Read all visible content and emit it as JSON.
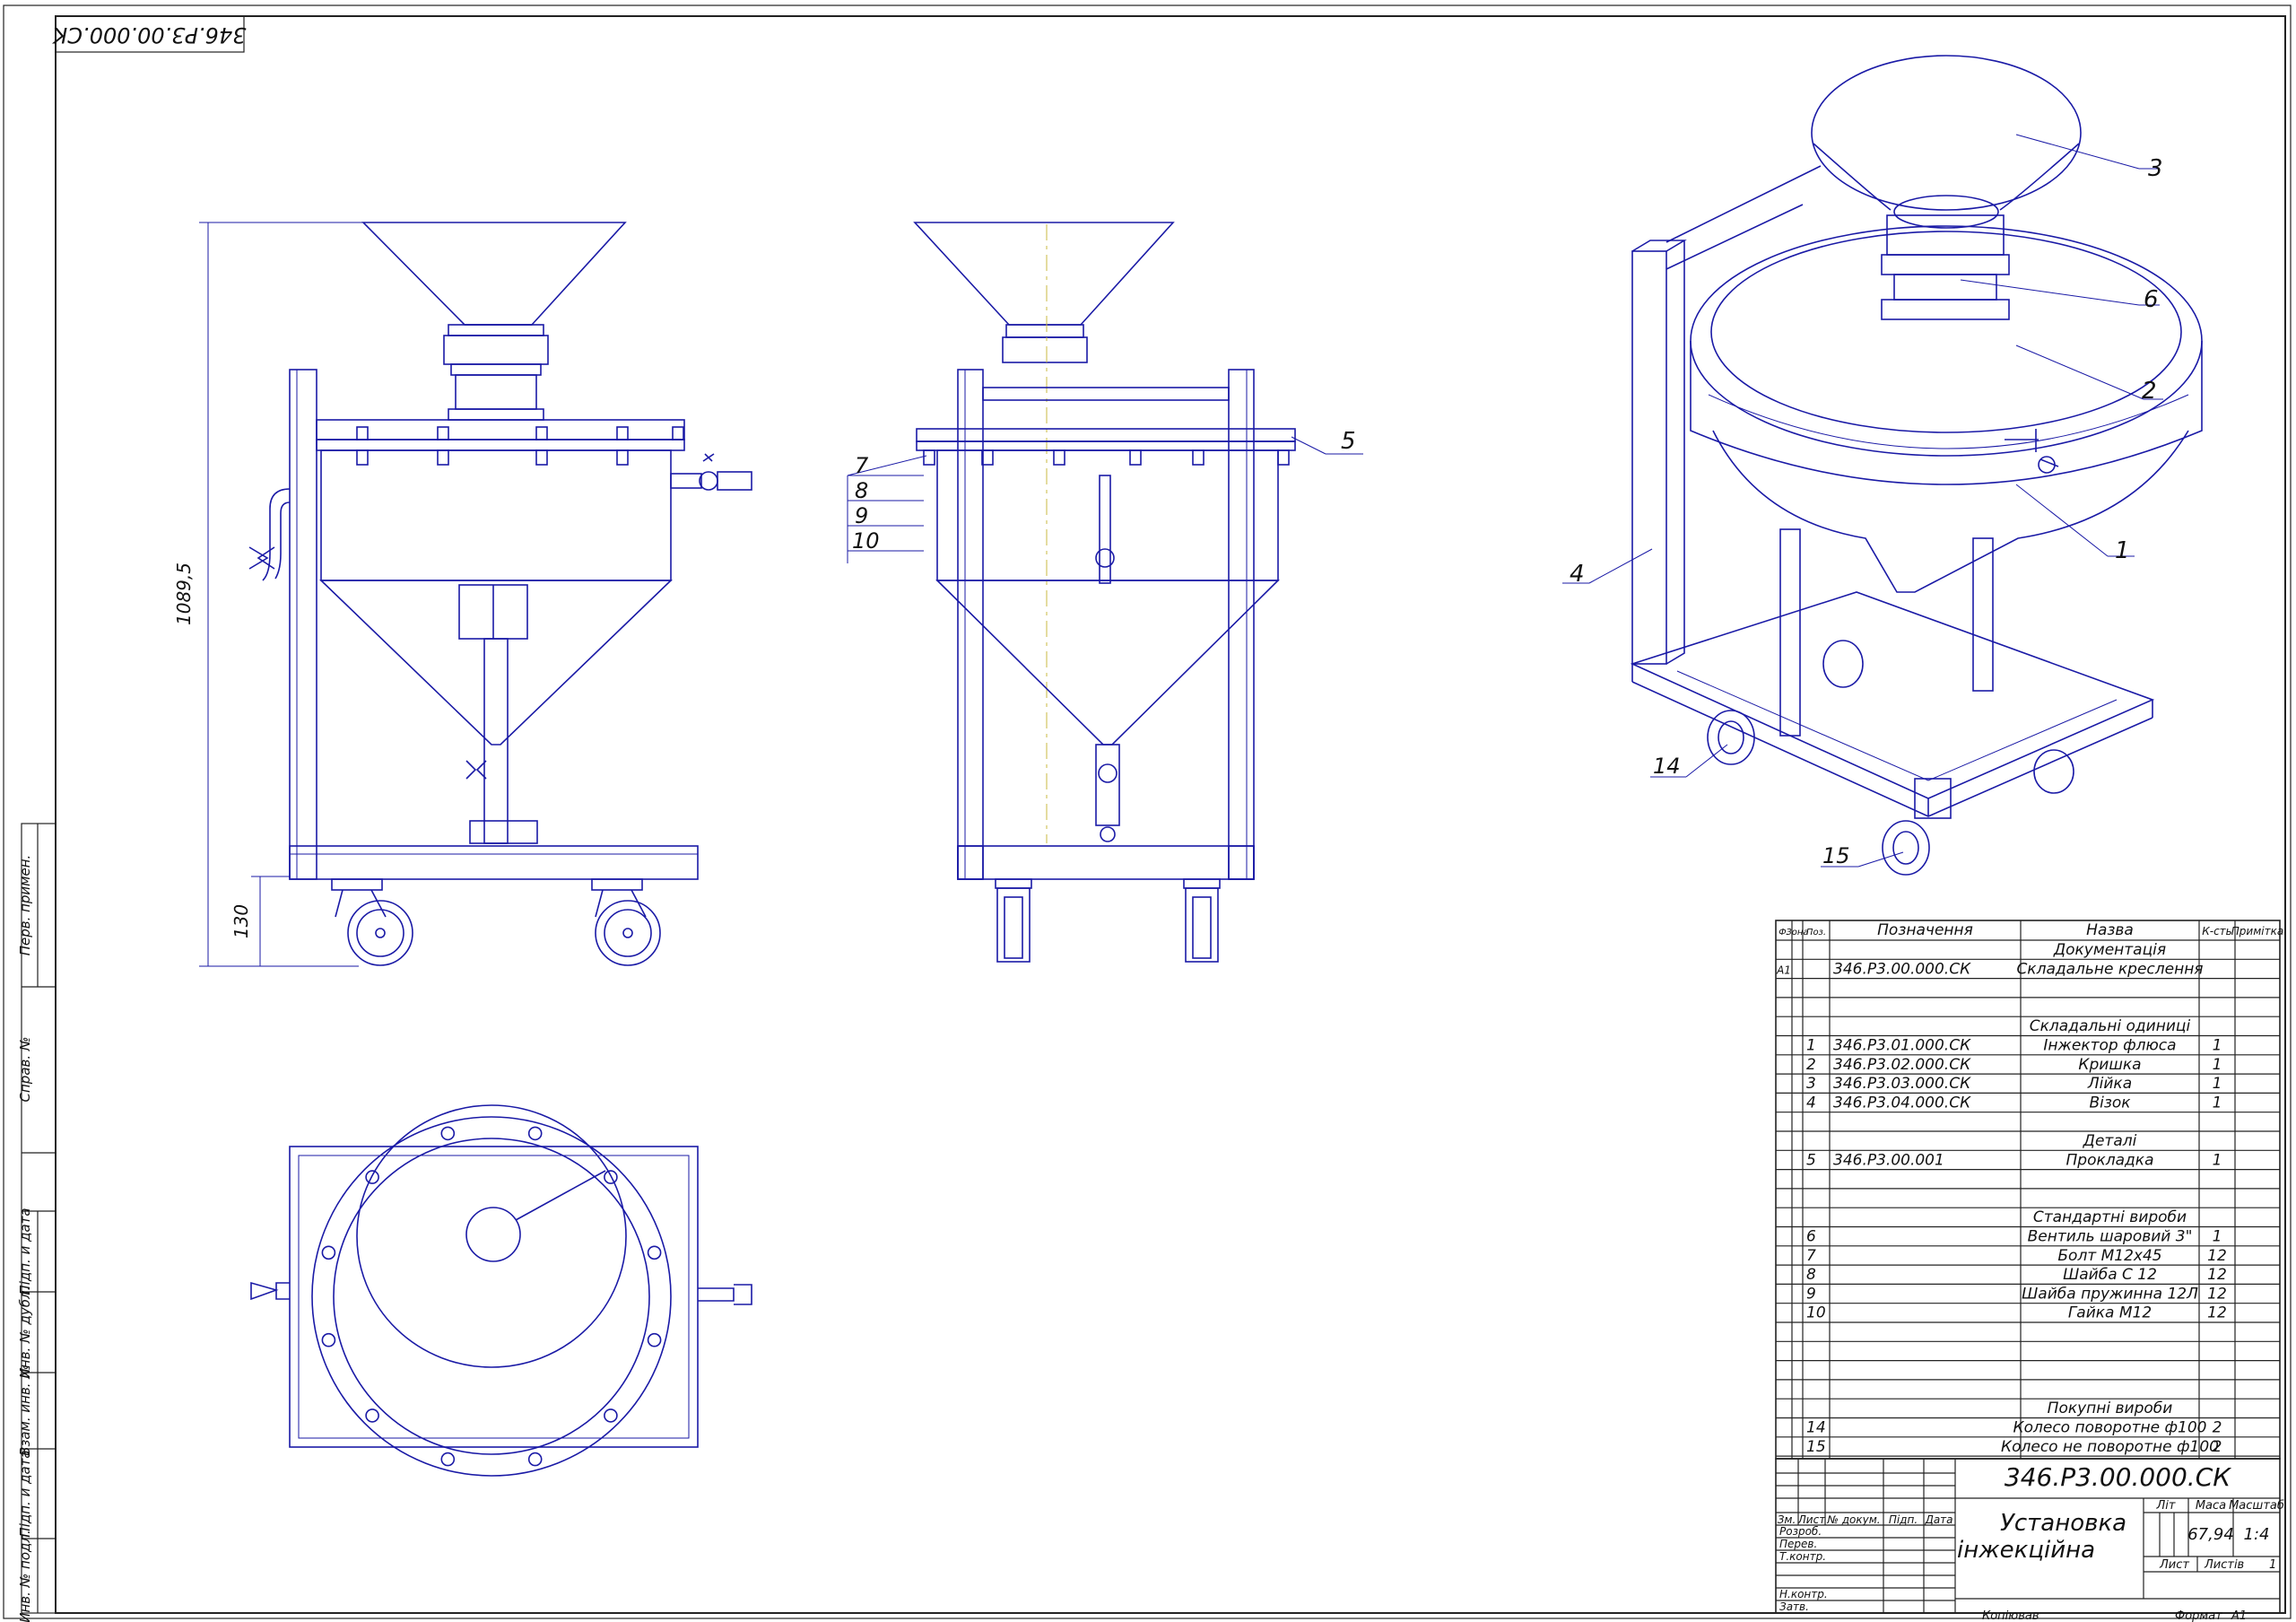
{
  "stamp_code": "346.P3.00.000.CK",
  "dimensions": {
    "height": "1089,5",
    "wheel": "130"
  },
  "callouts": [
    "1",
    "2",
    "3",
    "4",
    "5",
    "6",
    "7",
    "8",
    "9",
    "10",
    "14",
    "15"
  ],
  "spec": {
    "headers": [
      "Ф.",
      "Зона",
      "Поз.",
      "Позначення",
      "Назва",
      "К-сть",
      "Примітка"
    ],
    "rows": [
      {
        "fmt": "",
        "zone": "",
        "pos": "",
        "des": "",
        "name": "Документація",
        "qty": "",
        "note": ""
      },
      {
        "fmt": "А1",
        "zone": "",
        "pos": "",
        "des": "346.Р3.00.000.СК",
        "name": "Складальне креслення",
        "qty": "",
        "note": ""
      },
      {
        "fmt": "",
        "zone": "",
        "pos": "",
        "des": "",
        "name": "",
        "qty": "",
        "note": ""
      },
      {
        "fmt": "",
        "zone": "",
        "pos": "",
        "des": "",
        "name": "",
        "qty": "",
        "note": ""
      },
      {
        "fmt": "",
        "zone": "",
        "pos": "",
        "des": "",
        "name": "Складальні одиниці",
        "qty": "",
        "note": ""
      },
      {
        "fmt": "",
        "zone": "",
        "pos": "1",
        "des": "346.Р3.01.000.СК",
        "name": "Інжектор флюса",
        "qty": "1",
        "note": ""
      },
      {
        "fmt": "",
        "zone": "",
        "pos": "2",
        "des": "346.Р3.02.000.СК",
        "name": "Кришка",
        "qty": "1",
        "note": ""
      },
      {
        "fmt": "",
        "zone": "",
        "pos": "3",
        "des": "346.Р3.03.000.СК",
        "name": "Лійка",
        "qty": "1",
        "note": ""
      },
      {
        "fmt": "",
        "zone": "",
        "pos": "4",
        "des": "346.Р3.04.000.СК",
        "name": "Візок",
        "qty": "1",
        "note": ""
      },
      {
        "fmt": "",
        "zone": "",
        "pos": "",
        "des": "",
        "name": "",
        "qty": "",
        "note": ""
      },
      {
        "fmt": "",
        "zone": "",
        "pos": "",
        "des": "",
        "name": "Деталі",
        "qty": "",
        "note": ""
      },
      {
        "fmt": "",
        "zone": "",
        "pos": "5",
        "des": "346.Р3.00.001",
        "name": "Прокладка",
        "qty": "1",
        "note": ""
      },
      {
        "fmt": "",
        "zone": "",
        "pos": "",
        "des": "",
        "name": "",
        "qty": "",
        "note": ""
      },
      {
        "fmt": "",
        "zone": "",
        "pos": "",
        "des": "",
        "name": "",
        "qty": "",
        "note": ""
      },
      {
        "fmt": "",
        "zone": "",
        "pos": "",
        "des": "",
        "name": "Стандартні вироби",
        "qty": "",
        "note": ""
      },
      {
        "fmt": "",
        "zone": "",
        "pos": "6",
        "des": "",
        "name": "Вентиль шаровий 3\"",
        "qty": "1",
        "note": ""
      },
      {
        "fmt": "",
        "zone": "",
        "pos": "7",
        "des": "",
        "name": "Болт М12х45",
        "qty": "12",
        "note": ""
      },
      {
        "fmt": "",
        "zone": "",
        "pos": "8",
        "des": "",
        "name": "Шайба С 12",
        "qty": "12",
        "note": ""
      },
      {
        "fmt": "",
        "zone": "",
        "pos": "9",
        "des": "",
        "name": "Шайба пружинна 12Л",
        "qty": "12",
        "note": ""
      },
      {
        "fmt": "",
        "zone": "",
        "pos": "10",
        "des": "",
        "name": "Гайка М12",
        "qty": "12",
        "note": ""
      },
      {
        "fmt": "",
        "zone": "",
        "pos": "",
        "des": "",
        "name": "",
        "qty": "",
        "note": ""
      },
      {
        "fmt": "",
        "zone": "",
        "pos": "",
        "des": "",
        "name": "",
        "qty": "",
        "note": ""
      },
      {
        "fmt": "",
        "zone": "",
        "pos": "",
        "des": "",
        "name": "",
        "qty": "",
        "note": ""
      },
      {
        "fmt": "",
        "zone": "",
        "pos": "",
        "des": "",
        "name": "",
        "qty": "",
        "note": ""
      },
      {
        "fmt": "",
        "zone": "",
        "pos": "",
        "des": "",
        "name": "Покупні вироби",
        "qty": "",
        "note": ""
      },
      {
        "fmt": "",
        "zone": "",
        "pos": "14",
        "des": "",
        "name": "Колесо поворотне ф100",
        "qty": "2",
        "note": ""
      },
      {
        "fmt": "",
        "zone": "",
        "pos": "15",
        "des": "",
        "name": "Колесо не поворотне ф100",
        "qty": "2",
        "note": ""
      }
    ]
  },
  "title_block": {
    "doc_code": "346.Р3.00.000.СК",
    "title_line1": "Установка",
    "title_line2": "інжекційна",
    "lit_label": "Літ",
    "mass_label": "Маса",
    "scale_label": "Масштаб",
    "mass": "67,94",
    "scale": "1:4",
    "sheet_label": "Лист",
    "sheets_label": "Листів",
    "sheets": "1",
    "col_izm": "Зм.",
    "col_list": "Лист",
    "col_doc": "№ докум.",
    "col_sign": "Підп.",
    "col_date": "Дата",
    "roles": [
      "Розроб.",
      "Перев.",
      "Т.контр.",
      "",
      "Н.контр.",
      "Затв."
    ],
    "copied": "Копіював",
    "format_label": "Формат",
    "format": "А1"
  },
  "side_strip": [
    "Перв. примен.",
    "Справ. №",
    "Підп. и дата",
    "Инв. № дубл.",
    "Взам. инв. №",
    "Підп. и дата",
    "Инв. № подл."
  ]
}
